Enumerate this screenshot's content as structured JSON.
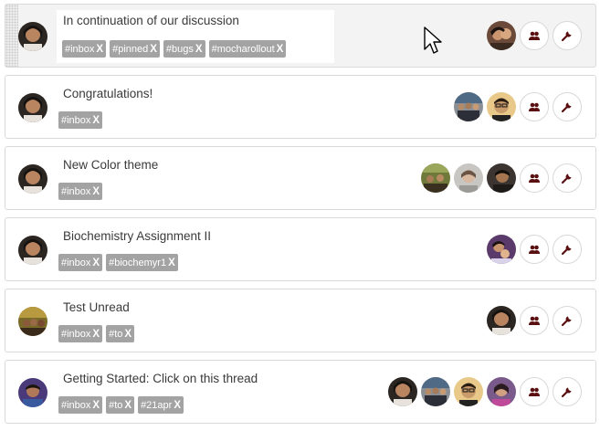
{
  "threads": [
    {
      "title": "In continuation of our discussion",
      "selected": true,
      "tags": [
        "#inbox",
        "#pinned",
        "#bugs",
        "#mocharollout"
      ],
      "participants": [
        "woman-dark-hair-avatar"
      ]
    },
    {
      "title": "Congratulations!",
      "selected": false,
      "tags": [
        "#inbox"
      ],
      "participants": [
        "group-photo-avatar",
        "glasses-man-avatar"
      ]
    },
    {
      "title": "New Color theme",
      "selected": false,
      "tags": [
        "#inbox"
      ],
      "participants": [
        "outdoor-avatar",
        "grey-avatar",
        "dark-avatar"
      ]
    },
    {
      "title": "Biochemistry Assignment II",
      "selected": false,
      "tags": [
        "#inbox",
        "#biochemyr1"
      ],
      "participants": [
        "woman-child-avatar"
      ]
    },
    {
      "title": "Test Unread",
      "selected": false,
      "tags": [
        "#inbox",
        "#to"
      ],
      "participants": [
        "man-avatar"
      ]
    },
    {
      "title": "Getting Started: Click on this thread",
      "selected": false,
      "tags": [
        "#inbox",
        "#to",
        "#21apr"
      ],
      "participants": [
        "man-avatar",
        "group-photo-avatar",
        "glasses-man-avatar",
        "purple-woman-avatar"
      ]
    }
  ],
  "tag_remove_symbol": "X",
  "icons": {
    "members": "people-icon",
    "settings": "wrench-icon"
  },
  "colors": {
    "tag_bg": "#a3a3a3",
    "icon": "#5a1010",
    "border": "#d9d9d9"
  }
}
